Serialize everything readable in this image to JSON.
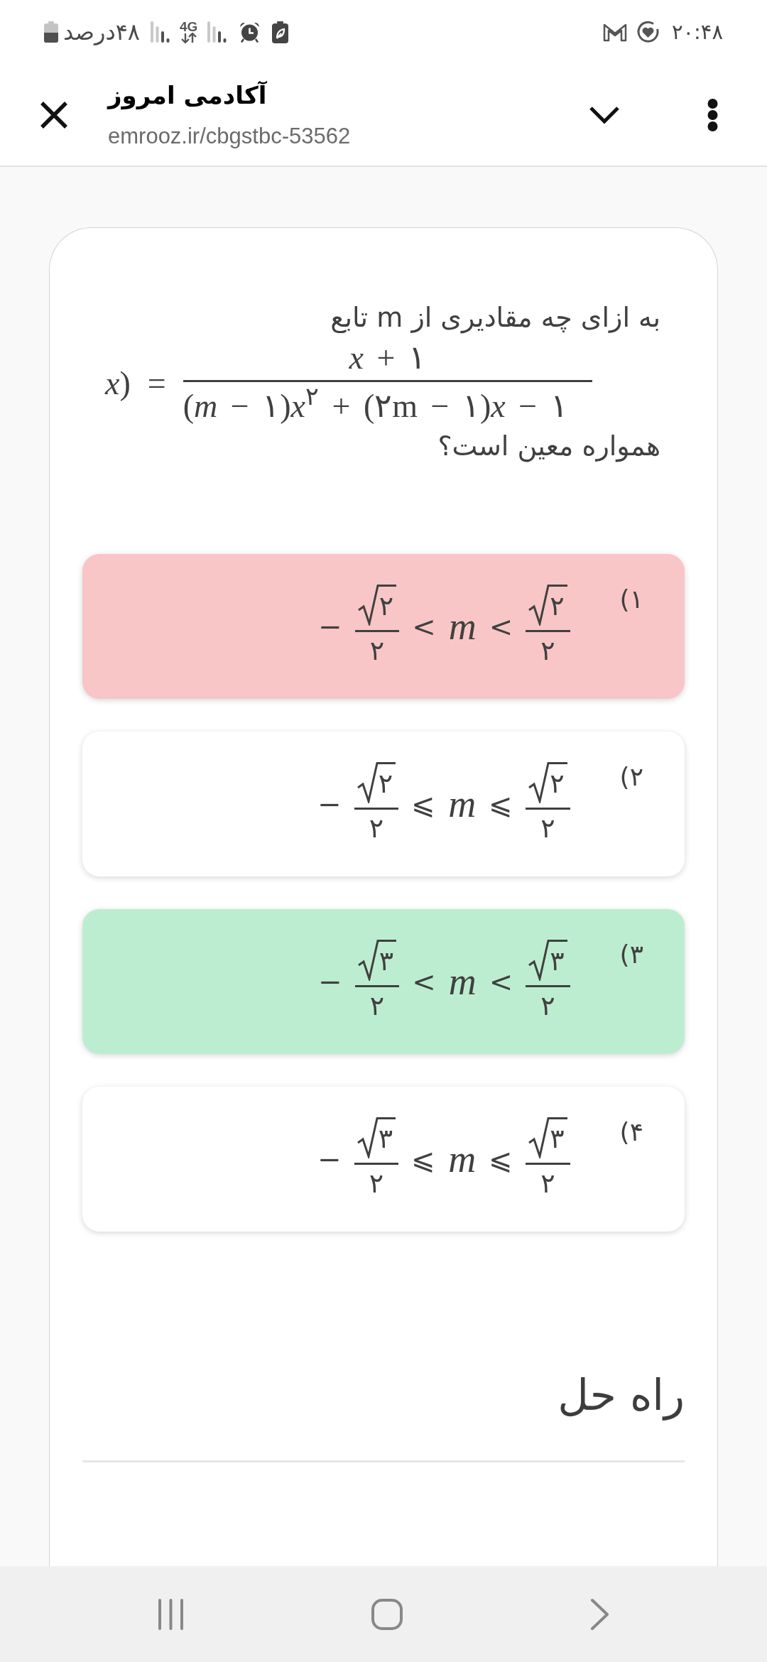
{
  "status_bar": {
    "battery": "۴۸درصد",
    "network_type": "4G",
    "time": "۲۰:۴۸"
  },
  "header": {
    "title": "آکادمی امروز",
    "url": "emrooz.ir/cbgstbc-53562"
  },
  "question": {
    "text_before": "به ازای چه مقادیری از m تابع",
    "formula": {
      "lead": "*x*)",
      "relation": "=",
      "numerator": "*x* + ۱",
      "denominator": "(*m* − ۱)*x*$^{۲}$ + (۲m − ۱)*x* − ۱"
    },
    "text_after": "همواره معین است؟"
  },
  "options": [
    {
      "label": "۱)",
      "selected": true,
      "correct": false,
      "expression": {
        "sign": "−",
        "left_fraction": {
          "radical": true,
          "numerator": "۲",
          "denominator": "۲"
        },
        "relation_1": "<",
        "variable": "m",
        "relation_2": "<",
        "right_fraction": {
          "radical": true,
          "numerator": "۲",
          "denominator": "۲"
        }
      }
    },
    {
      "label": "۲)",
      "selected": false,
      "correct": false,
      "expression": {
        "sign": "−",
        "left_fraction": {
          "radical": true,
          "numerator": "۲",
          "denominator": "۲"
        },
        "relation_1": "⩽",
        "variable": "m",
        "relation_2": "⩽",
        "right_fraction": {
          "radical": true,
          "numerator": "۲",
          "denominator": "۲"
        }
      }
    },
    {
      "label": "۳)",
      "selected": false,
      "correct": true,
      "expression": {
        "sign": "−",
        "left_fraction": {
          "radical": true,
          "numerator": "۳",
          "denominator": "۲"
        },
        "relation_1": "<",
        "variable": "m",
        "relation_2": "<",
        "right_fraction": {
          "radical": true,
          "numerator": "۳",
          "denominator": "۲"
        }
      }
    },
    {
      "label": "۴)",
      "selected": false,
      "correct": false,
      "expression": {
        "sign": "−",
        "left_fraction": {
          "radical": true,
          "numerator": "۳",
          "denominator": "۲"
        },
        "relation_1": "⩽",
        "variable": "m",
        "relation_2": "⩽",
        "right_fraction": {
          "radical": true,
          "numerator": "۳",
          "denominator": "۲"
        }
      }
    }
  ],
  "solution": {
    "heading": "راه حل"
  }
}
